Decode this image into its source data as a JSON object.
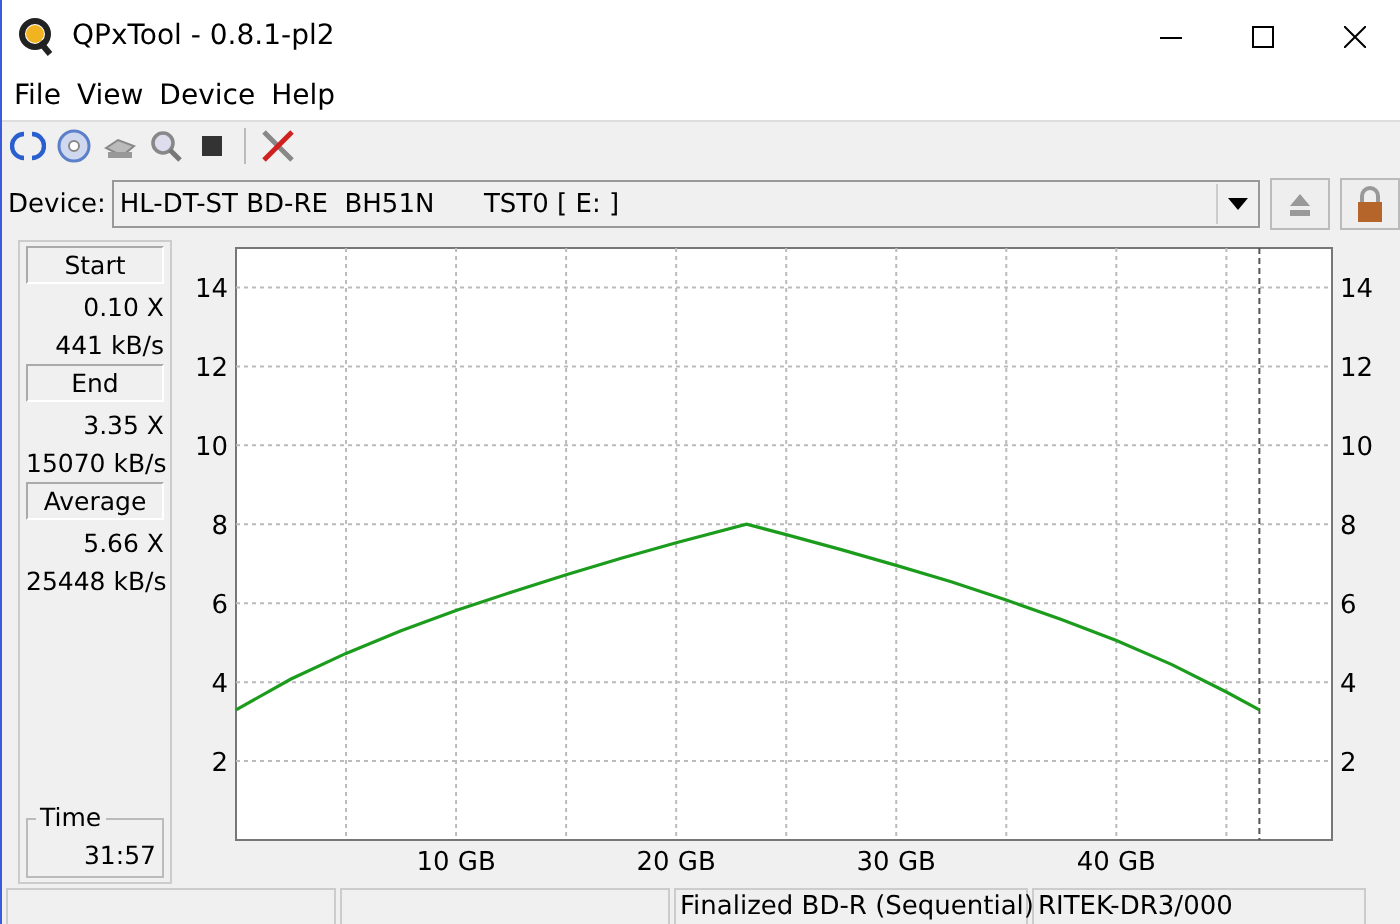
{
  "window": {
    "title": "QPxTool - 0.8.1-pl2"
  },
  "menu": [
    {
      "label": "File"
    },
    {
      "label": "View"
    },
    {
      "label": "Device"
    },
    {
      "label": "Help"
    }
  ],
  "device": {
    "label": "Device:",
    "value": "HL-DT-ST BD-RE  BH51N      TST0 [ E: ]"
  },
  "stats": [
    {
      "heading": "Start",
      "speed": "0.10 X",
      "rate": "441 kB/s"
    },
    {
      "heading": "End",
      "speed": "3.35 X",
      "rate": "15070 kB/s"
    },
    {
      "heading": "Average",
      "speed": "5.66 X",
      "rate": "25448 kB/s"
    }
  ],
  "time": {
    "label": "Time",
    "value": "31:57"
  },
  "chart_data": {
    "type": "line",
    "x": [
      0,
      2.5,
      5,
      7.5,
      10,
      12.5,
      15,
      17.5,
      20,
      23.2,
      25,
      27.5,
      30,
      32.5,
      35,
      37.5,
      40,
      42.5,
      45,
      46.5
    ],
    "series": [
      {
        "color": "#1c9c1c",
        "values": [
          3.3,
          4.08,
          4.73,
          5.3,
          5.81,
          6.28,
          6.72,
          7.14,
          7.53,
          8.0,
          7.74,
          7.36,
          6.96,
          6.54,
          6.08,
          5.59,
          5.05,
          4.45,
          3.75,
          3.3
        ]
      }
    ],
    "xlim": [
      0,
      49.8
    ],
    "ylim": [
      0,
      15
    ],
    "xticks": [
      {
        "value": 10,
        "label": "10 GB"
      },
      {
        "value": 20,
        "label": "20 GB"
      },
      {
        "value": 30,
        "label": "30 GB"
      },
      {
        "value": 40,
        "label": "40 GB"
      }
    ],
    "yticks": [
      2,
      4,
      6,
      8,
      10,
      12,
      14
    ],
    "y2ticks": [
      2,
      4,
      6,
      8,
      10,
      12,
      14
    ],
    "y2lim": [
      0,
      15
    ],
    "grid": true,
    "ref_lines": [
      {
        "axis": "x",
        "value": 46.5,
        "color": "#555555"
      }
    ]
  },
  "status_bar": {
    "sections": [
      "Finalized BD-R (Sequential)",
      "RITEK-DR3/000"
    ]
  }
}
